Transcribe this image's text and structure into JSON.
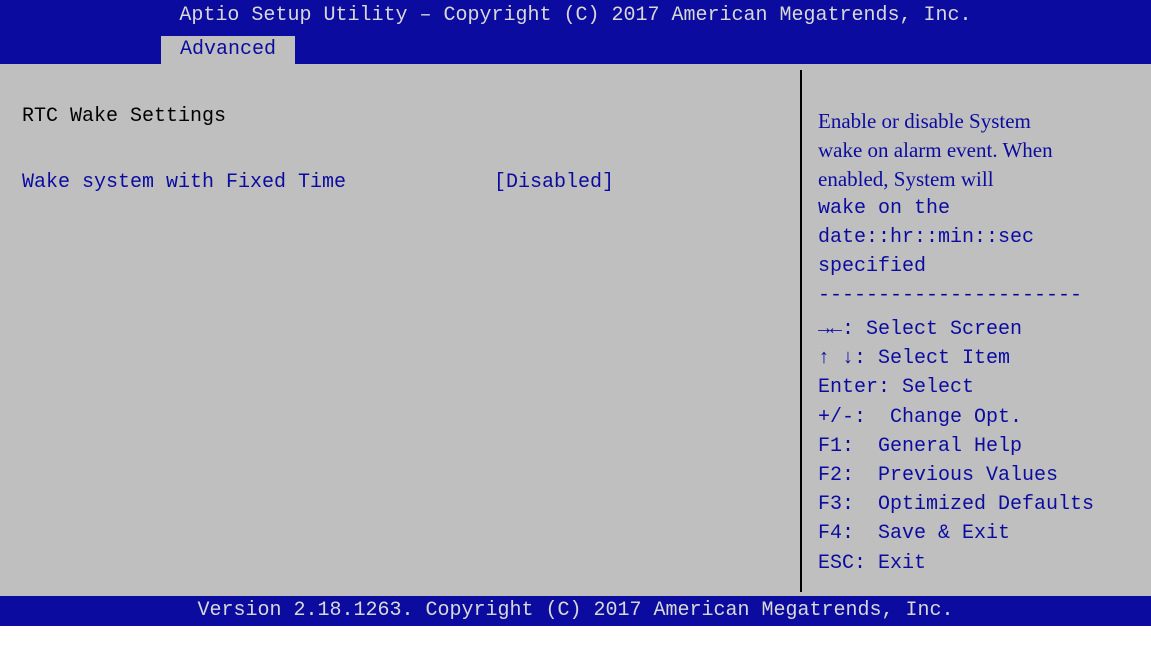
{
  "window": {
    "title": "Aptio Setup Utility – Copyright (C) 2017 American Megatrends, Inc."
  },
  "tabs": [
    {
      "label": "Advanced"
    }
  ],
  "main": {
    "section_title": "RTC Wake Settings",
    "settings": [
      {
        "label": "Wake system with Fixed Time",
        "value": "[Disabled]"
      }
    ]
  },
  "help": {
    "lines": [
      "Enable or disable System",
      "wake on alarm event. When",
      "enabled, System will",
      "wake on the",
      "date::hr::min::sec",
      "specified"
    ],
    "separator": "----------------------"
  },
  "keys": [
    {
      "key": "→←",
      "desc": ": Select Screen"
    },
    {
      "key": "↑ ↓",
      "desc": ": Select Item"
    },
    {
      "key": "Enter",
      "desc": ": Select"
    },
    {
      "key": "+/-",
      "desc": ":  Change Opt."
    },
    {
      "key": "F1",
      "desc": ":  General Help"
    },
    {
      "key": "F2",
      "desc": ":  Previous Values"
    },
    {
      "key": "F3",
      "desc": ":  Optimized Defaults"
    },
    {
      "key": "F4",
      "desc": ":  Save & Exit"
    },
    {
      "key": "ESC",
      "desc": ": Exit"
    }
  ],
  "footer": {
    "text": "Version 2.18.1263. Copyright (C) 2017 American Megatrends, Inc."
  },
  "colors": {
    "background": "#bfbfbf",
    "bar": "#0b0ba0",
    "bar_text": "#d8d8d8",
    "accent_text": "#0b0ba0",
    "normal_text": "#000000"
  }
}
